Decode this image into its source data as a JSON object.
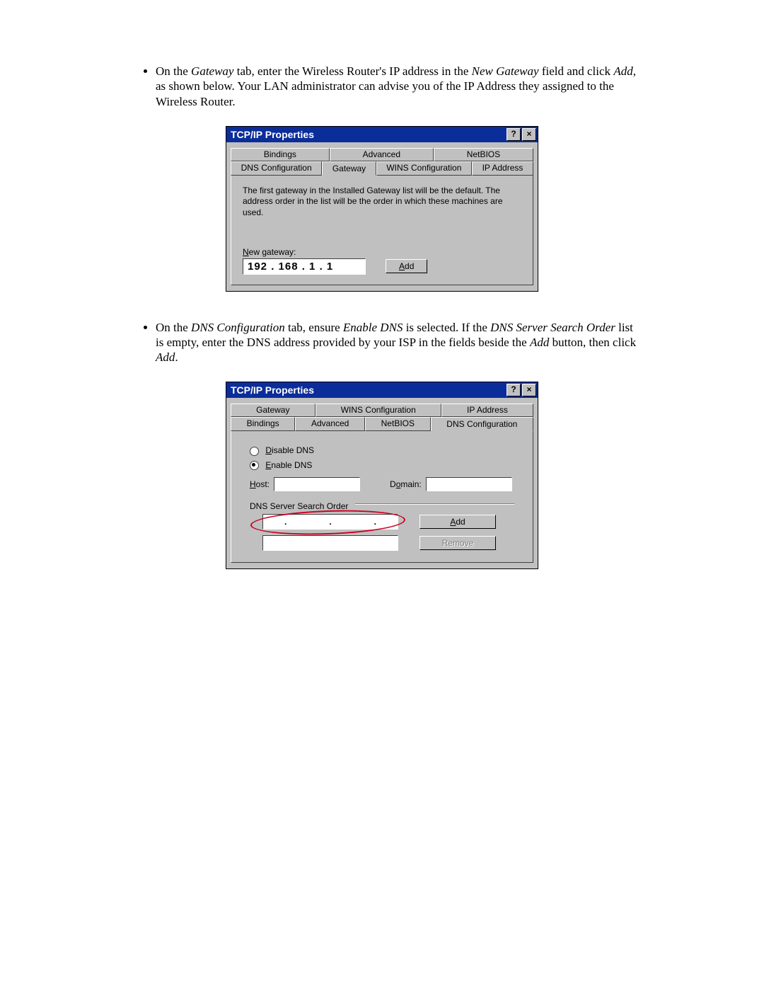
{
  "bullet1": {
    "parts": [
      {
        "t": "On the "
      },
      {
        "t": "Gateway",
        "i": true
      },
      {
        "t": " tab, enter the Wireless Router's IP address in the "
      },
      {
        "t": "New Gateway",
        "i": true
      },
      {
        "t": " field and click "
      },
      {
        "t": "Add",
        "i": true
      },
      {
        "t": ", as shown below. Your LAN administrator can advise you of the IP Address they assigned to the Wireless Router."
      }
    ]
  },
  "bullet2": {
    "parts": [
      {
        "t": "On the "
      },
      {
        "t": "DNS Configuration",
        "i": true
      },
      {
        "t": " tab, ensure "
      },
      {
        "t": "Enable DNS",
        "i": true
      },
      {
        "t": " is selected. If the "
      },
      {
        "t": "DNS Server Search Order",
        "i": true
      },
      {
        "t": " list is empty, enter the DNS address provided by your ISP in the fields beside the "
      },
      {
        "t": "Add",
        "i": true
      },
      {
        "t": " button, then click "
      },
      {
        "t": "Add",
        "i": true
      },
      {
        "t": "."
      }
    ]
  },
  "dialog1": {
    "title": "TCP/IP Properties",
    "help": "?",
    "close": "×",
    "tabs_row1": [
      "Bindings",
      "Advanced",
      "NetBIOS"
    ],
    "tabs_row2": [
      "DNS Configuration",
      "Gateway",
      "WINS Configuration",
      "IP Address"
    ],
    "active_tab": "Gateway",
    "desc": "The first gateway in the Installed Gateway list will be the default. The address order in the list will be the order in which these machines are used.",
    "new_gateway_label_pre": "N",
    "new_gateway_label_post": "ew gateway:",
    "ip_value": "192 . 168 .   1   .   1",
    "add_btn_u": "A",
    "add_btn_rest": "dd"
  },
  "dialog2": {
    "title": "TCP/IP Properties",
    "help": "?",
    "close": "×",
    "tabs_row1": [
      "Gateway",
      "WINS Configuration",
      "IP Address"
    ],
    "tabs_row2": [
      "Bindings",
      "Advanced",
      "NetBIOS",
      "DNS Configuration"
    ],
    "active_tab": "DNS Configuration",
    "radio_disable_u": "D",
    "radio_disable_rest": "isable DNS",
    "radio_enable_u": "E",
    "radio_enable_rest": "nable DNS",
    "host_u": "H",
    "host_rest": "ost:",
    "domain_pre": "D",
    "domain_u": "o",
    "domain_rest": "main:",
    "group_label": "DNS Server Search Order",
    "add_btn_u": "A",
    "add_btn_rest": "dd",
    "remove_btn_u": "R",
    "remove_btn_rest": "emove",
    "dot": "."
  }
}
